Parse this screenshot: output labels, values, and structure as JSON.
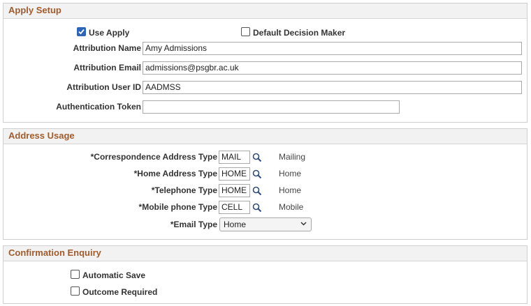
{
  "apply_setup": {
    "title": "Apply Setup",
    "use_apply_label": "Use Apply",
    "use_apply_checked": true,
    "default_decision_maker_label": "Default Decision Maker",
    "default_decision_maker_checked": false,
    "attribution_name_label": "Attribution Name",
    "attribution_name_value": "Amy Admissions",
    "attribution_email_label": "Attribution Email",
    "attribution_email_value": "admissions@psgbr.ac.uk",
    "attribution_user_id_label": "Attribution User ID",
    "attribution_user_id_value": "AADMSS",
    "authentication_token_label": "Authentication Token",
    "authentication_token_value": ""
  },
  "address_usage": {
    "title": "Address Usage",
    "rows": [
      {
        "label": "*Correspondence Address Type",
        "value": "MAIL",
        "description": "Mailing"
      },
      {
        "label": "*Home Address Type",
        "value": "HOME",
        "description": "Home"
      },
      {
        "label": "*Telephone Type",
        "value": "HOME",
        "description": "Home"
      },
      {
        "label": "*Mobile phone Type",
        "value": "CELL",
        "description": "Mobile"
      }
    ],
    "email_type_label": "*Email Type",
    "email_type_value": "Home"
  },
  "confirmation_enquiry": {
    "title": "Confirmation Enquiry",
    "automatic_save_label": "Automatic Save",
    "automatic_save_checked": false,
    "outcome_required_label": "Outcome Required",
    "outcome_required_checked": false
  },
  "colors": {
    "section_title": "#a25b2b",
    "checkbox_checked": "#2f64b6"
  }
}
